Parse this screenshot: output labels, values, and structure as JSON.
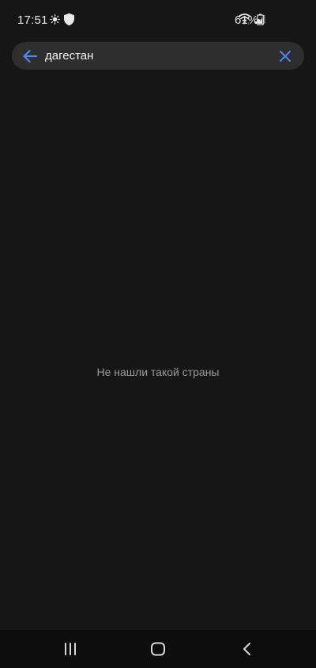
{
  "status_bar": {
    "time": "17:51",
    "battery_percent": "61%",
    "icons": [
      "brightness-icon",
      "shield-icon",
      "wifi-icon",
      "signal-icon",
      "battery-icon"
    ]
  },
  "search": {
    "query": "дагестан",
    "accent_color": "#4c86ef"
  },
  "empty_state": {
    "message": "Не нашли такой страны"
  },
  "nav_bar": {
    "buttons": [
      "recent-apps-icon",
      "home-icon",
      "back-icon"
    ]
  }
}
